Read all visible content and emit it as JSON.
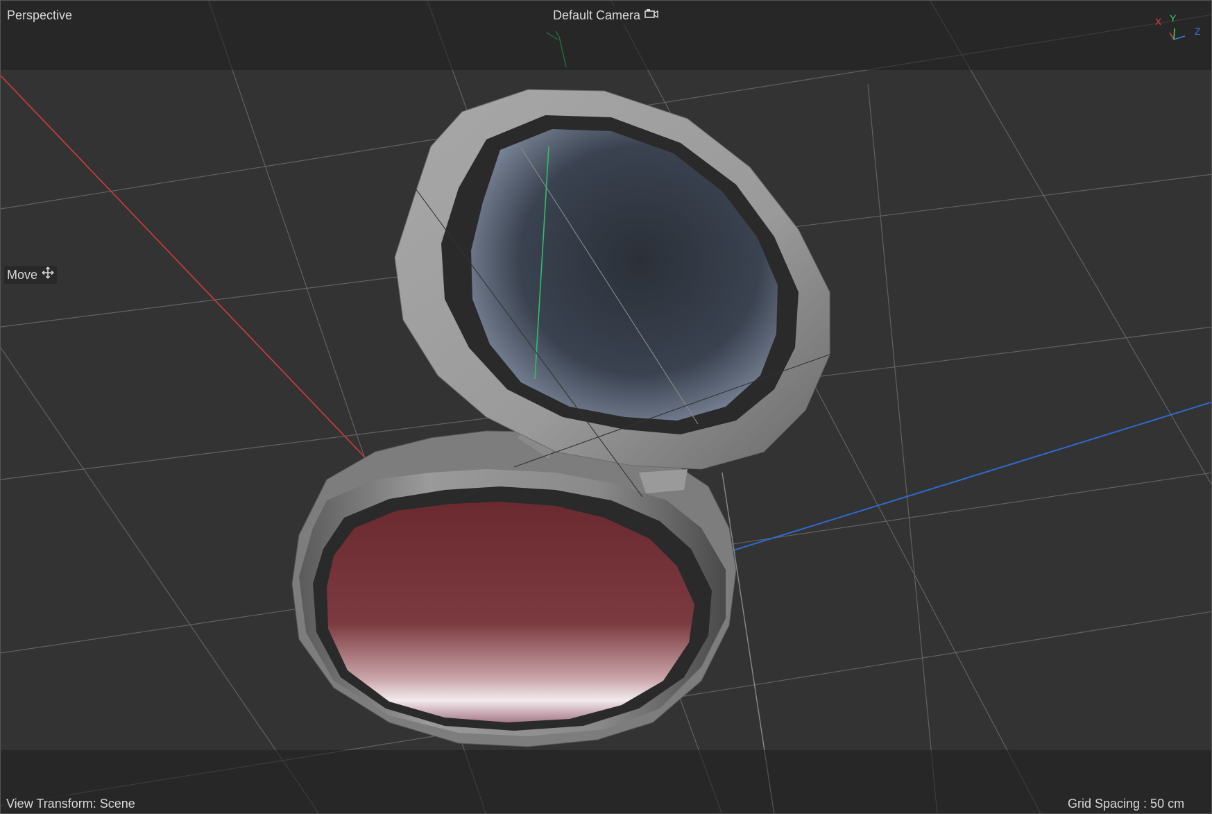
{
  "viewport": {
    "view_name": "Perspective",
    "camera_name": "Default Camera",
    "camera_icon": "camera-icon",
    "tool_name": "Move",
    "tool_icon": "move-icon",
    "view_transform": "View Transform: Scene",
    "grid_spacing": "Grid Spacing : 50 cm"
  },
  "axis_gizmo": {
    "x_label": "X",
    "y_label": "Y",
    "z_label": "Z",
    "x_color": "#e03a3a",
    "y_color": "#3ad16a",
    "z_color": "#3a7ae0"
  },
  "colors": {
    "background": "#333333",
    "grid_line": "#6a6a6a",
    "x_axis": "#d23c3c",
    "y_axis": "#2fbf6a",
    "z_axis": "#2f6ad0",
    "object_body": "#9a9a9a"
  }
}
